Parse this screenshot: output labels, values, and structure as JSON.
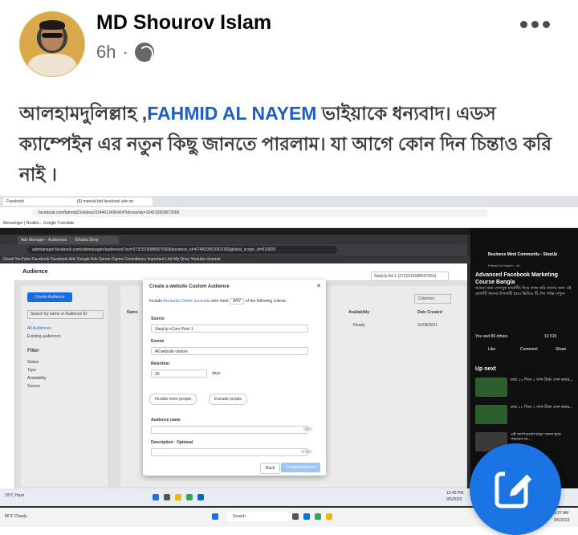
{
  "post": {
    "author": "MD Shourov Islam",
    "time": "6h",
    "separator": "·",
    "globe_icon": "globe-icon",
    "text_before": "আলহামদুলিল্লাহ ,",
    "mention": "FAHMID AL NAYEM",
    "text_after": " ভাইয়াকে ধন্যবাদ। এডস ক্যাম্পেইন এর নতুন কিছু জানতে পারলাম। যা আগে কোন দিন চিন্তাও করি নাই ।"
  },
  "screenshot": {
    "outer_tab1": "Facebook",
    "outer_tab2": "(8) manual bid facebook ads on",
    "outer_address": "facebook.com/fahmid23/videos/3244013495424?idorvanity=104215959672569",
    "outer_bookmarks": "Messenger | Realtin...   Google Translate",
    "inner_tab1": "Ads Manager - Audiences",
    "inner_tab2": "Elhaba Shop",
    "inner_address": "adsmanager.facebook.com/adsmanager/audiences?act=2731515088657050&business_id=674820951061192&global_scope_id=610820",
    "inner_bookmarks": "Gmail   YouTube   Facebook   Facebook Ads   Google Ads   Server   Figma   Consultancy   Important Link   My Drive   Youtube channel",
    "section": "Audience",
    "create_audience": "Create Audience",
    "search_placeholder": "Search by name or Audience ID",
    "all_audiences": "All Audiences",
    "existing_audiences": "Existing audiences",
    "filter": "Filter",
    "filter_items": [
      "Status",
      "Type",
      "Availability",
      "Source"
    ],
    "col_name": "Name",
    "col_availability": "Availability",
    "col_date": "Date Created",
    "row_status": "Ready",
    "row_date": "31/08/2021",
    "account_select": "StepUp Ad 1 (2731515088657050)",
    "columns_btn": "Columns",
    "modal": {
      "title": "Create a website Custom Audience",
      "include_prefix": "Include",
      "include_link": "Accounts Centre accounts",
      "include_suffix": "who meet",
      "any": "ANY",
      "criteria": "of the following criteria:",
      "source_label": "Source",
      "source_value": "StepUp eCom Pixel 1",
      "events_label": "Events",
      "events_value": "All website visitors",
      "retention_label": "Retention",
      "retention_value": "30",
      "retention_unit": "days",
      "include_more": "Include more people",
      "exclude": "Exclude people",
      "name_label": "Audience name",
      "name_count": "0/50",
      "desc_label": "Description · Optional",
      "desc_count": "0/100",
      "back": "Back",
      "create": "Create Audience"
    },
    "yt": {
      "channel": "Business Mind Community - StepUp",
      "channel_sub": "Fahmid Al Nayem · 4h",
      "title": "Advanced Facebook Marketing Course Bangla",
      "body": "আমরা যারা ফেসবুক মার্কেটিং নিয়ে কাজ করি তাদের জন্য এই কোর্সটি অনেক উপকারী হবে। ভিডিও টি শেষ পর্যন্ত দেখুন।",
      "reactions": "You and 80 others",
      "counts": "13   515",
      "like": "Like",
      "comment": "Comment",
      "share": "Share",
      "up_next": "Up next",
      "items": [
        {
          "text": "মাত্র ১০ দিনে ১ লাখ টাকা সেল করার...",
          "sub": "Business Mind Co...",
          "meta": "4 days ago · 3.8K views",
          "duration": "1:09:04"
        },
        {
          "text": "মাত্র ১০ দিনে ১ লাখ টাকা সেল করার...",
          "sub": "Business Mind Co...",
          "meta": "4 days ago · 2.1K views",
          "duration": "2:18:03"
        },
        {
          "text": "এই অ্যাপগুলো ছাড়া সফল হতে পারবেন না...",
          "sub": "Business Mind Co...",
          "meta": "",
          "duration": ""
        }
      ],
      "see_all": "See all"
    },
    "taskbar1_weather": "29°C Haze",
    "taskbar1_time": "12:45 PM",
    "taskbar1_date": "9/5/2023",
    "taskbar2_weather": "86°F Cloudy",
    "taskbar2_search": "Search",
    "taskbar2_time": "9:37 AM",
    "taskbar2_date": "9/5/2023"
  },
  "colors": {
    "mention": "#1d5fbf",
    "fab": "#1b74e4",
    "create_button": "#1877f2"
  },
  "fab_icon": "edit-icon"
}
